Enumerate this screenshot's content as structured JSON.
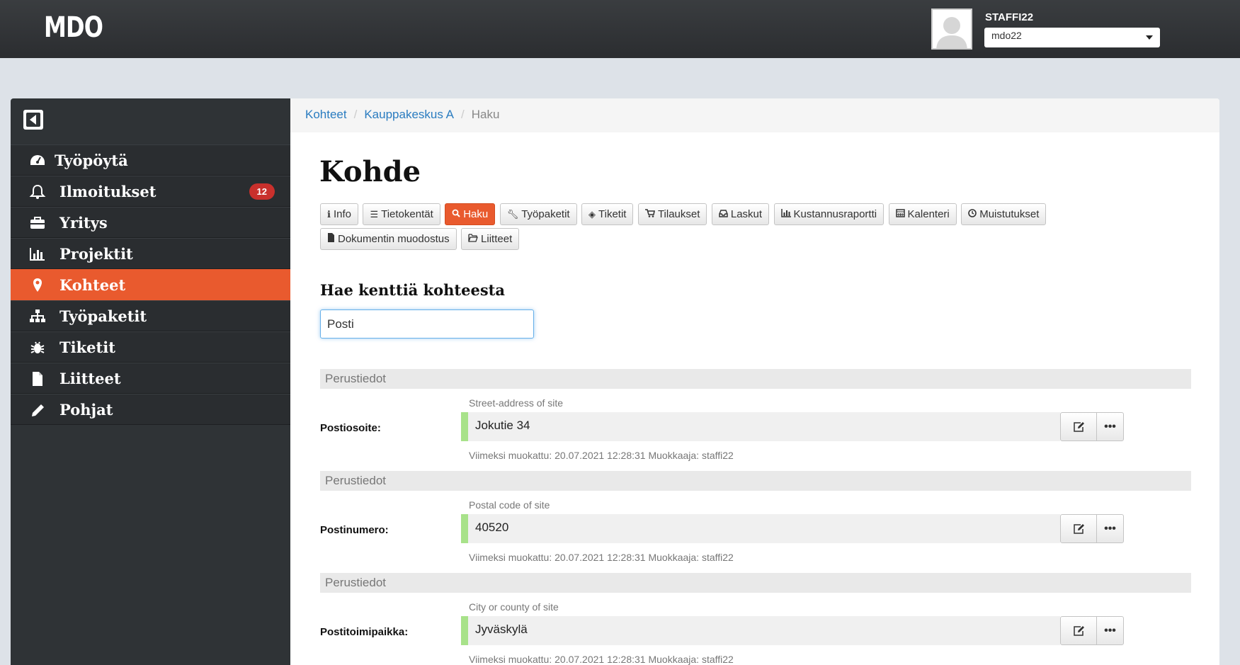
{
  "app": {
    "logo": "MDO"
  },
  "user": {
    "name": "STAFFI22",
    "selected": "mdo22"
  },
  "sidebar": {
    "items": [
      {
        "label": "Työpöytä",
        "icon": "dashboard-icon"
      },
      {
        "label": "Ilmoitukset",
        "icon": "bell-icon",
        "badge": "12"
      },
      {
        "label": "Yritys",
        "icon": "briefcase-icon"
      },
      {
        "label": "Projektit",
        "icon": "bar-chart-icon"
      },
      {
        "label": "Kohteet",
        "icon": "map-marker-icon",
        "active": true
      },
      {
        "label": "Työpaketit",
        "icon": "sitemap-icon"
      },
      {
        "label": "Tiketit",
        "icon": "bug-icon"
      },
      {
        "label": "Liitteet",
        "icon": "file-icon"
      },
      {
        "label": "Pohjat",
        "icon": "pencil-icon"
      }
    ]
  },
  "breadcrumb": {
    "items": [
      "Kohteet",
      "Kauppakeskus A"
    ],
    "current": "Haku"
  },
  "page": {
    "title": "Kohde"
  },
  "tabs": [
    {
      "label": "Info",
      "icon": "info-icon"
    },
    {
      "label": "Tietokentät",
      "icon": "list-icon"
    },
    {
      "label": "Haku",
      "icon": "search-icon",
      "active": true
    },
    {
      "label": "Työpaketit",
      "icon": "wrench-icon"
    },
    {
      "label": "Tiketit",
      "icon": "tag-icon"
    },
    {
      "label": "Tilaukset",
      "icon": "cart-icon"
    },
    {
      "label": "Laskut",
      "icon": "inbox-icon"
    },
    {
      "label": "Kustannusraportti",
      "icon": "bar-chart-icon"
    },
    {
      "label": "Kalenteri",
      "icon": "calendar-icon"
    },
    {
      "label": "Muistutukset",
      "icon": "clock-icon"
    },
    {
      "label": "Dokumentin muodostus",
      "icon": "file-icon"
    },
    {
      "label": "Liitteet",
      "icon": "folder-open-icon"
    }
  ],
  "search": {
    "title": "Hae kenttiä kohteesta",
    "value": "Posti"
  },
  "fields": [
    {
      "group": "Perustiedot",
      "label": "Postiosoite:",
      "description": "Street-address of site",
      "value": "Jokutie 34",
      "meta": "Viimeksi muokattu: 20.07.2021 12:28:31 Muokkaaja: staffi22"
    },
    {
      "group": "Perustiedot",
      "label": "Postinumero:",
      "description": "Postal code of site",
      "value": "40520",
      "meta": "Viimeksi muokattu: 20.07.2021 12:28:31 Muokkaaja: staffi22"
    },
    {
      "group": "Perustiedot",
      "label": "Postitoimipaikka:",
      "description": "City or county of site",
      "value": "Jyväskylä",
      "meta": "Viimeksi muokattu: 20.07.2021 12:28:31 Muokkaaja: staffi22"
    }
  ],
  "more_label": "•••",
  "colors": {
    "accent": "#e95a2e",
    "link": "#2a7cc0",
    "badge": "#c9302c",
    "field_marker": "#a8e28a"
  }
}
